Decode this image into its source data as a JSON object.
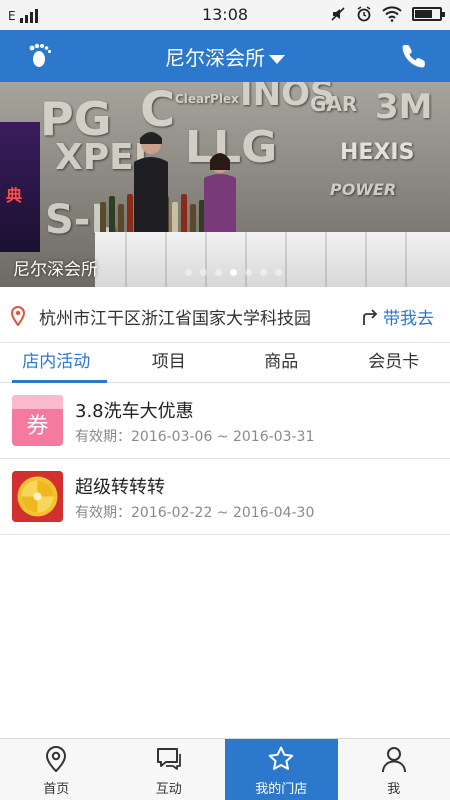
{
  "status_bar": {
    "network": "E",
    "time": "13:08"
  },
  "header": {
    "title": "尼尔深会所"
  },
  "banner": {
    "caption": "尼尔深会所",
    "slide_count": 7,
    "active_slide": 4
  },
  "address": {
    "text": "杭州市江干区浙江省国家大学科技园",
    "navigate_label": "带我去"
  },
  "tabs": [
    {
      "label": "店内活动",
      "active": true
    },
    {
      "label": "项目",
      "active": false
    },
    {
      "label": "商品",
      "active": false
    },
    {
      "label": "会员卡",
      "active": false
    }
  ],
  "activities": [
    {
      "title": "3.8洗车大优惠",
      "validity": "有效期：2016-03-06 ~ 2016-03-31",
      "icon": "coupon-icon",
      "icon_text": "券"
    },
    {
      "title": "超级转转转",
      "validity": "有效期：2016-02-22 ~ 2016-04-30",
      "icon": "lucky-wheel-icon"
    }
  ],
  "bottom_nav": [
    {
      "label": "首页",
      "icon": "location-pin-icon",
      "active": false
    },
    {
      "label": "互动",
      "icon": "chat-icon",
      "active": false
    },
    {
      "label": "我的门店",
      "icon": "star-icon",
      "active": true
    },
    {
      "label": "我",
      "icon": "person-icon",
      "active": false
    }
  ],
  "colors": {
    "primary": "#2b78cc",
    "coupon": "#f57aa0",
    "wheel": "#d22f2f"
  }
}
